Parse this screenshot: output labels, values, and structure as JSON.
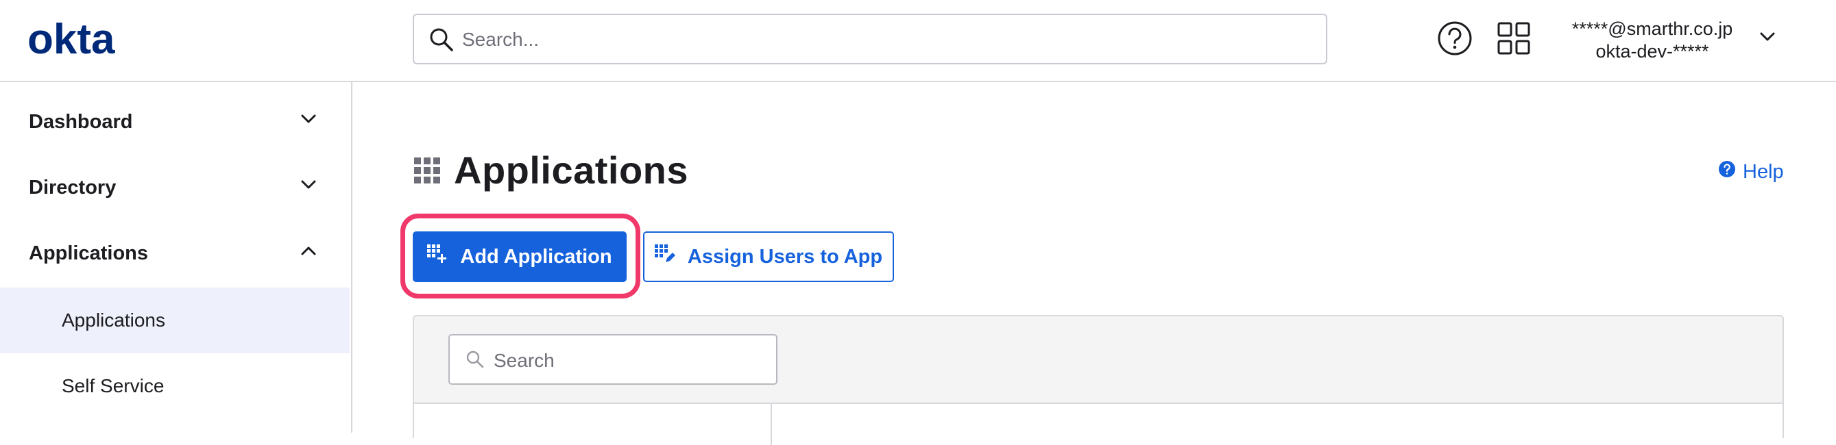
{
  "header": {
    "logo_text": "okta",
    "search_placeholder": "Search...",
    "user_email": "*****@smarthr.co.jp",
    "org_name": "okta-dev-*****"
  },
  "sidebar": {
    "items": [
      {
        "label": "Dashboard",
        "expanded": false
      },
      {
        "label": "Directory",
        "expanded": false
      },
      {
        "label": "Applications",
        "expanded": true
      }
    ],
    "subitems": [
      {
        "label": "Applications",
        "active": true
      },
      {
        "label": "Self Service",
        "active": false
      }
    ]
  },
  "main": {
    "title": "Applications",
    "help_label": "Help",
    "add_button_label": "Add Application",
    "assign_button_label": "Assign Users to App",
    "list_search_placeholder": "Search"
  },
  "colors": {
    "brand": "#00297a",
    "primary": "#1662dd",
    "highlight": "#f0386b",
    "active_bg": "#eef0fb"
  }
}
